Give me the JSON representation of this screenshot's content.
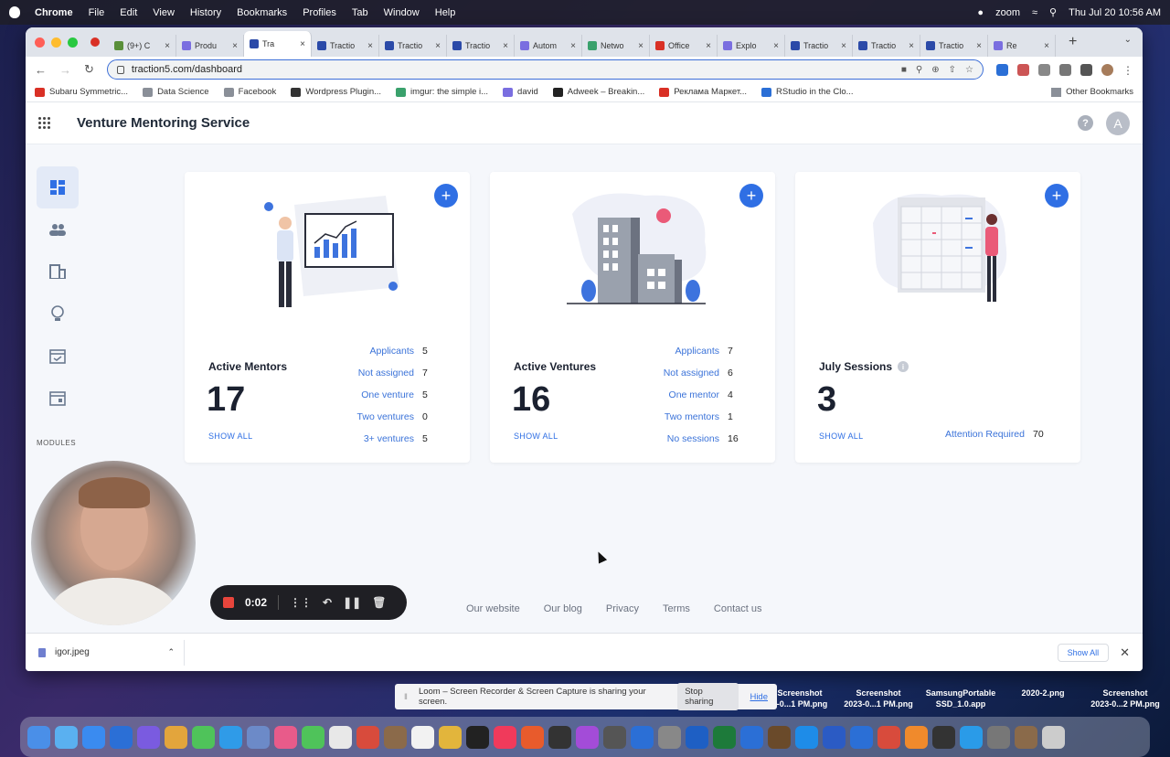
{
  "os": {
    "menubar": [
      "Chrome",
      "File",
      "Edit",
      "View",
      "History",
      "Bookmarks",
      "Profiles",
      "Tab",
      "Window",
      "Help"
    ],
    "status_zoom": "zoom",
    "clock": "Thu Jul 20  10:56 AM"
  },
  "browser": {
    "tabs": [
      {
        "label": "(9+) C",
        "color": "#5a8f3a"
      },
      {
        "label": "Produ",
        "color": "#7a6ee0"
      },
      {
        "label": "Tra",
        "color": "#2b4aa8",
        "active": true
      },
      {
        "label": "Tractio",
        "color": "#2b4aa8"
      },
      {
        "label": "Tractio",
        "color": "#2b4aa8"
      },
      {
        "label": "Tractio",
        "color": "#2b4aa8"
      },
      {
        "label": "Autom",
        "color": "#7a6ee0"
      },
      {
        "label": "Netwo",
        "color": "#3aa16c"
      },
      {
        "label": "Office",
        "color": "#d93025"
      },
      {
        "label": "Explo",
        "color": "#7a6ee0"
      },
      {
        "label": "Tractio",
        "color": "#2b4aa8"
      },
      {
        "label": "Tractio",
        "color": "#2b4aa8"
      },
      {
        "label": "Tractio",
        "color": "#2b4aa8"
      },
      {
        "label": "Re",
        "color": "#7a6ee0"
      }
    ],
    "url": "traction5.com/dashboard",
    "bookmarks": [
      {
        "label": "Subaru Symmetric...",
        "color": "#d93025"
      },
      {
        "label": "Data Science",
        "color": "#8a8f98"
      },
      {
        "label": "Facebook",
        "color": "#8a8f98"
      },
      {
        "label": "Wordpress Plugin...",
        "color": "#333"
      },
      {
        "label": "imgur: the simple i...",
        "color": "#3aa16c"
      },
      {
        "label": "david",
        "color": "#7a6ee0"
      },
      {
        "label": "Adweek – Breakin...",
        "color": "#222"
      },
      {
        "label": "Реклама Маркет...",
        "color": "#d93025"
      },
      {
        "label": "RStudio in the Clo...",
        "color": "#2b6fd6"
      }
    ],
    "other_bookmarks": "Other Bookmarks"
  },
  "app": {
    "title": "Venture Mentoring Service",
    "help": "?",
    "avatar_letter": "A",
    "modules_label": "MODULES",
    "accent": "#2f6fe4",
    "cards": [
      {
        "title": "Active Mentors",
        "count": "17",
        "show_all": "SHOW ALL",
        "stats": [
          {
            "label": "Applicants",
            "value": "5"
          },
          {
            "label": "Not assigned",
            "value": "7"
          },
          {
            "label": "One venture",
            "value": "5"
          },
          {
            "label": "Two ventures",
            "value": "0"
          },
          {
            "label": "3+ ventures",
            "value": "5"
          }
        ]
      },
      {
        "title": "Active Ventures",
        "count": "16",
        "show_all": "SHOW ALL",
        "stats": [
          {
            "label": "Applicants",
            "value": "7"
          },
          {
            "label": "Not assigned",
            "value": "6"
          },
          {
            "label": "One mentor",
            "value": "4"
          },
          {
            "label": "Two mentors",
            "value": "1"
          },
          {
            "label": "No sessions",
            "value": "16"
          }
        ]
      },
      {
        "title": "July Sessions",
        "count": "3",
        "show_all": "SHOW ALL",
        "stats": [
          {
            "label": "Attention Required",
            "value": "70"
          }
        ]
      }
    ],
    "footer": [
      "Our website",
      "Our blog",
      "Privacy",
      "Terms",
      "Contact us"
    ]
  },
  "downloads": {
    "file": "igor.jpeg",
    "show_all": "Show All"
  },
  "recorder": {
    "time": "0:02"
  },
  "loom": {
    "message": "Loom – Screen Recorder & Screen Capture is sharing your screen.",
    "stop": "Stop sharing",
    "hide": "Hide"
  },
  "desktop_files": [
    {
      "name": "Screenshot\n3-0...1 PM.png"
    },
    {
      "name": "Screenshot\n2023-0...1 PM.png"
    },
    {
      "name": "SamsungPortable\nSSD_1.0.app"
    },
    {
      "name": "2020-2.png"
    },
    {
      "name": "Screenshot\n2023-0...2 PM.png"
    }
  ]
}
